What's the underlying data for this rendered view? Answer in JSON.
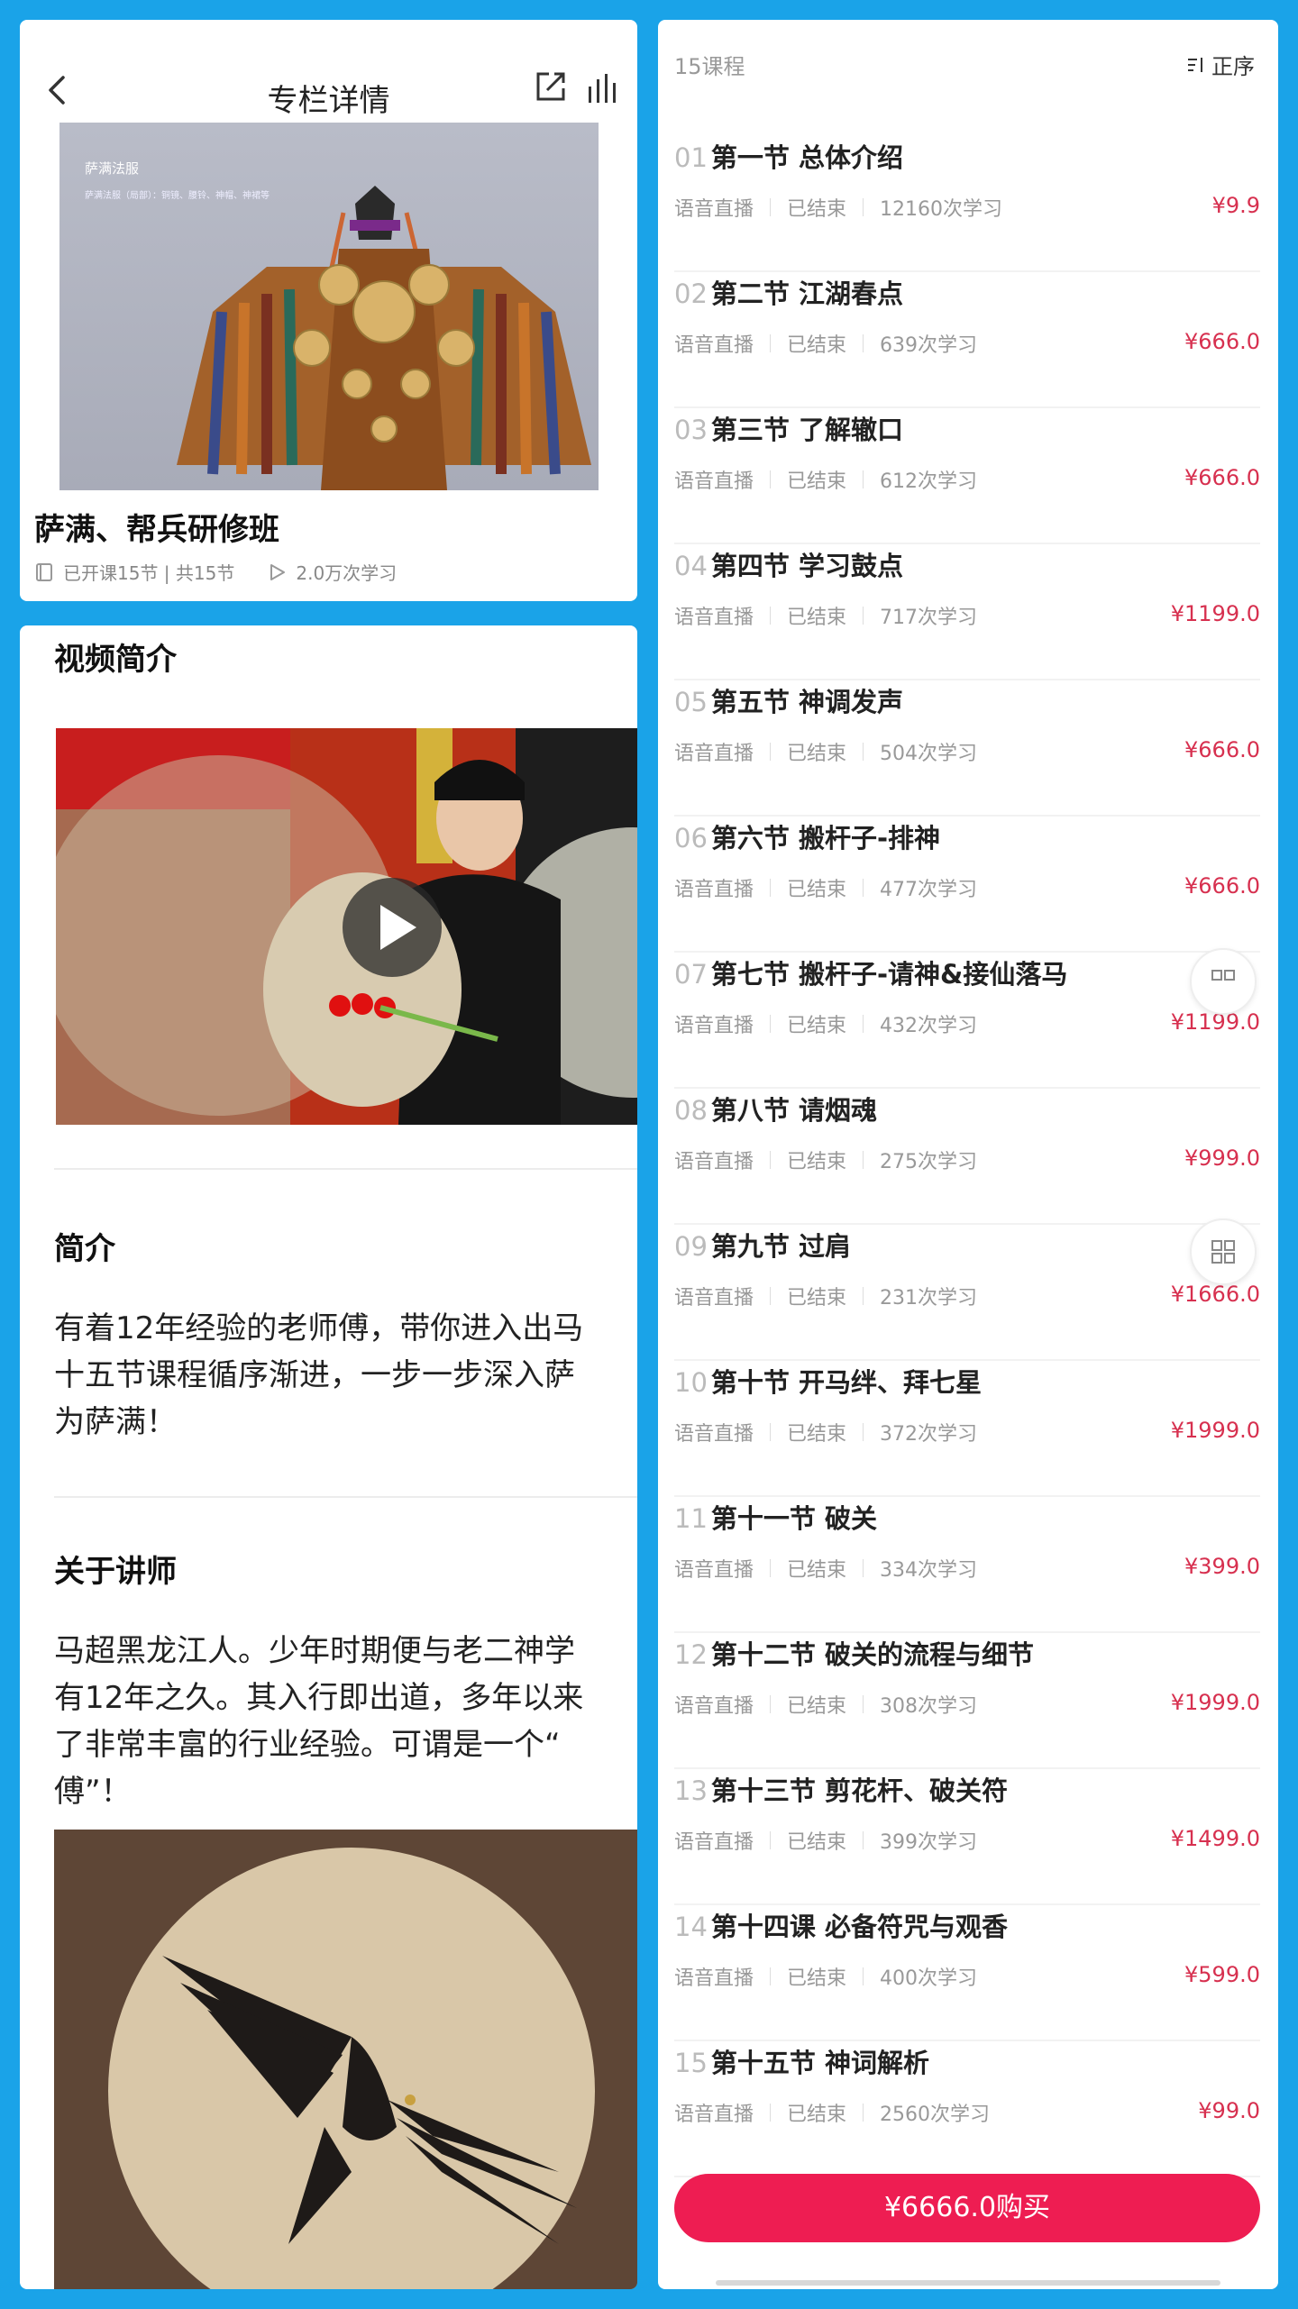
{
  "nav": {
    "title": "专栏详情"
  },
  "cover": {
    "caption": "萨满法服",
    "subcaption": "萨满法服（局部）：铜镜、腰铃、神帽、神裙等"
  },
  "course": {
    "title": "萨满、帮兵研修班",
    "lessons_info": "已开课15节 | 共15节",
    "learn_count": "2.0万次学习"
  },
  "intro": {
    "video_heading": "视频简介",
    "summary_heading": "简介",
    "summary_text": "有着12年经验的老师傅，带你进入出马\n十五节课程循序渐进，一步一步深入萨\n为萨满！",
    "teacher_heading": "关于讲师",
    "teacher_text": "马超黑龙江人。少年时期便与老二神学\n有12年之久。其入行即出道，多年以来\n了非常丰富的行业经验。可谓是一个“\n傅”！"
  },
  "list": {
    "count_label": "15课程",
    "sort_label": "正序",
    "lessons": [
      {
        "num": "01",
        "title": "第一节 总体介绍",
        "type": "语音直播",
        "status": "已结束",
        "views": "12160次学习",
        "price": "¥9.9"
      },
      {
        "num": "02",
        "title": "第二节 江湖春点",
        "type": "语音直播",
        "status": "已结束",
        "views": "639次学习",
        "price": "¥666.0"
      },
      {
        "num": "03",
        "title": "第三节 了解辙口",
        "type": "语音直播",
        "status": "已结束",
        "views": "612次学习",
        "price": "¥666.0"
      },
      {
        "num": "04",
        "title": "第四节 学习鼓点",
        "type": "语音直播",
        "status": "已结束",
        "views": "717次学习",
        "price": "¥1199.0"
      },
      {
        "num": "05",
        "title": "第五节 神调发声",
        "type": "语音直播",
        "status": "已结束",
        "views": "504次学习",
        "price": "¥666.0"
      },
      {
        "num": "06",
        "title": "第六节 搬杆子-排神",
        "type": "语音直播",
        "status": "已结束",
        "views": "477次学习",
        "price": "¥666.0"
      },
      {
        "num": "07",
        "title": "第七节 搬杆子-请神&接仙落马",
        "type": "语音直播",
        "status": "已结束",
        "views": "432次学习",
        "price": "¥1199.0"
      },
      {
        "num": "08",
        "title": "第八节 请烟魂",
        "type": "语音直播",
        "status": "已结束",
        "views": "275次学习",
        "price": "¥999.0"
      },
      {
        "num": "09",
        "title": "第九节 过肩",
        "type": "语音直播",
        "status": "已结束",
        "views": "231次学习",
        "price": "¥1666.0"
      },
      {
        "num": "10",
        "title": "第十节 开马绊、拜七星",
        "type": "语音直播",
        "status": "已结束",
        "views": "372次学习",
        "price": "¥1999.0"
      },
      {
        "num": "11",
        "title": "第十一节 破关",
        "type": "语音直播",
        "status": "已结束",
        "views": "334次学习",
        "price": "¥399.0"
      },
      {
        "num": "12",
        "title": "第十二节 破关的流程与细节",
        "type": "语音直播",
        "status": "已结束",
        "views": "308次学习",
        "price": "¥1999.0"
      },
      {
        "num": "13",
        "title": "第十三节 剪花杆、破关符",
        "type": "语音直播",
        "status": "已结束",
        "views": "399次学习",
        "price": "¥1499.0"
      },
      {
        "num": "14",
        "title": "第十四课 必备符咒与观香",
        "type": "语音直播",
        "status": "已结束",
        "views": "400次学习",
        "price": "¥599.0"
      },
      {
        "num": "15",
        "title": "第十五节 神词解析",
        "type": "语音直播",
        "status": "已结束",
        "views": "2560次学习",
        "price": "¥99.0"
      }
    ],
    "buy_label": "¥6666.0购买"
  },
  "colors": {
    "background": "#1aa3e8",
    "price": "#d7304f",
    "buy_button": "#ee1d52"
  },
  "icons": [
    "back-arrow-icon",
    "share-icon",
    "stats-icon",
    "book-icon",
    "play-count-icon",
    "sort-icon",
    "grid-icon"
  ]
}
